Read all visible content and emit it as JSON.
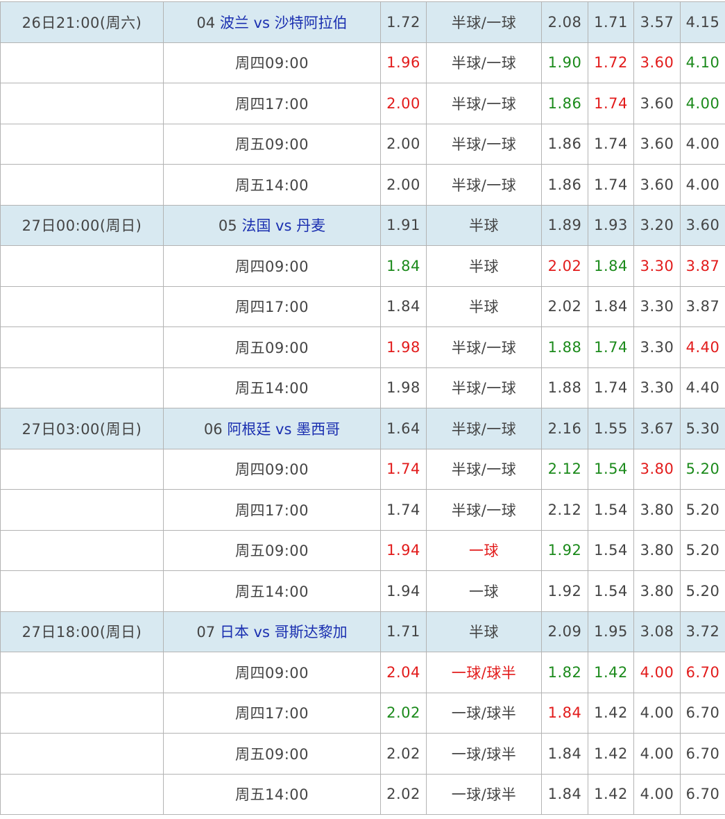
{
  "colors": {
    "header_bg": "#d8e9f1",
    "border": "#b3b3b3",
    "text": "#444444",
    "team_link": "#1a2fb0",
    "up": "#e21b1b",
    "down": "#1b8a1b"
  },
  "matches": [
    {
      "header": {
        "time": "26日21:00(周六)",
        "num": "04",
        "home": "波兰",
        "vs": "vs",
        "away": "沙特阿拉伯",
        "v": [
          "1.72",
          "半球/一球",
          "2.08",
          "1.71",
          "3.57",
          "4.15"
        ]
      },
      "updates": [
        {
          "time": "周四09:00",
          "v": [
            "1.96",
            "半球/一球",
            "1.90",
            "1.72",
            "3.60",
            "4.10"
          ],
          "c": [
            "red",
            "",
            "green",
            "red",
            "red",
            "green"
          ]
        },
        {
          "time": "周四17:00",
          "v": [
            "2.00",
            "半球/一球",
            "1.86",
            "1.74",
            "3.60",
            "4.00"
          ],
          "c": [
            "red",
            "",
            "green",
            "red",
            "",
            "green"
          ]
        },
        {
          "time": "周五09:00",
          "v": [
            "2.00",
            "半球/一球",
            "1.86",
            "1.74",
            "3.60",
            "4.00"
          ],
          "c": [
            "",
            "",
            "",
            "",
            "",
            ""
          ]
        },
        {
          "time": "周五14:00",
          "v": [
            "2.00",
            "半球/一球",
            "1.86",
            "1.74",
            "3.60",
            "4.00"
          ],
          "c": [
            "",
            "",
            "",
            "",
            "",
            ""
          ]
        }
      ]
    },
    {
      "header": {
        "time": "27日00:00(周日)",
        "num": "05",
        "home": "法国",
        "vs": "vs",
        "away": "丹麦",
        "v": [
          "1.91",
          "半球",
          "1.89",
          "1.93",
          "3.20",
          "3.60"
        ]
      },
      "updates": [
        {
          "time": "周四09:00",
          "v": [
            "1.84",
            "半球",
            "2.02",
            "1.84",
            "3.30",
            "3.87"
          ],
          "c": [
            "green",
            "",
            "red",
            "green",
            "red",
            "red"
          ]
        },
        {
          "time": "周四17:00",
          "v": [
            "1.84",
            "半球",
            "2.02",
            "1.84",
            "3.30",
            "3.87"
          ],
          "c": [
            "",
            "",
            "",
            "",
            "",
            ""
          ]
        },
        {
          "time": "周五09:00",
          "v": [
            "1.98",
            "半球/一球",
            "1.88",
            "1.74",
            "3.30",
            "4.40"
          ],
          "c": [
            "red",
            "",
            "green",
            "green",
            "",
            "red"
          ]
        },
        {
          "time": "周五14:00",
          "v": [
            "1.98",
            "半球/一球",
            "1.88",
            "1.74",
            "3.30",
            "4.40"
          ],
          "c": [
            "",
            "",
            "",
            "",
            "",
            ""
          ]
        }
      ]
    },
    {
      "header": {
        "time": "27日03:00(周日)",
        "num": "06",
        "home": "阿根廷",
        "vs": "vs",
        "away": "墨西哥",
        "v": [
          "1.64",
          "半球/一球",
          "2.16",
          "1.55",
          "3.67",
          "5.30"
        ]
      },
      "updates": [
        {
          "time": "周四09:00",
          "v": [
            "1.74",
            "半球/一球",
            "2.12",
            "1.54",
            "3.80",
            "5.20"
          ],
          "c": [
            "red",
            "",
            "green",
            "green",
            "red",
            "green"
          ]
        },
        {
          "time": "周四17:00",
          "v": [
            "1.74",
            "半球/一球",
            "2.12",
            "1.54",
            "3.80",
            "5.20"
          ],
          "c": [
            "",
            "",
            "",
            "",
            "",
            ""
          ]
        },
        {
          "time": "周五09:00",
          "v": [
            "1.94",
            "一球",
            "1.92",
            "1.54",
            "3.80",
            "5.20"
          ],
          "c": [
            "red",
            "red",
            "green",
            "",
            "",
            ""
          ]
        },
        {
          "time": "周五14:00",
          "v": [
            "1.94",
            "一球",
            "1.92",
            "1.54",
            "3.80",
            "5.20"
          ],
          "c": [
            "",
            "",
            "",
            "",
            "",
            ""
          ]
        }
      ]
    },
    {
      "header": {
        "time": "27日18:00(周日)",
        "num": "07",
        "home": "日本",
        "vs": "vs",
        "away": "哥斯达黎加",
        "v": [
          "1.71",
          "半球",
          "2.09",
          "1.95",
          "3.08",
          "3.72"
        ]
      },
      "updates": [
        {
          "time": "周四09:00",
          "v": [
            "2.04",
            "一球/球半",
            "1.82",
            "1.42",
            "4.00",
            "6.70"
          ],
          "c": [
            "red",
            "red",
            "green",
            "green",
            "red",
            "red"
          ]
        },
        {
          "time": "周四17:00",
          "v": [
            "2.02",
            "一球/球半",
            "1.84",
            "1.42",
            "4.00",
            "6.70"
          ],
          "c": [
            "green",
            "",
            "red",
            "",
            "",
            ""
          ]
        },
        {
          "time": "周五09:00",
          "v": [
            "2.02",
            "一球/球半",
            "1.84",
            "1.42",
            "4.00",
            "6.70"
          ],
          "c": [
            "",
            "",
            "",
            "",
            "",
            ""
          ]
        },
        {
          "time": "周五14:00",
          "v": [
            "2.02",
            "一球/球半",
            "1.84",
            "1.42",
            "4.00",
            "6.70"
          ],
          "c": [
            "",
            "",
            "",
            "",
            "",
            ""
          ]
        }
      ]
    }
  ]
}
